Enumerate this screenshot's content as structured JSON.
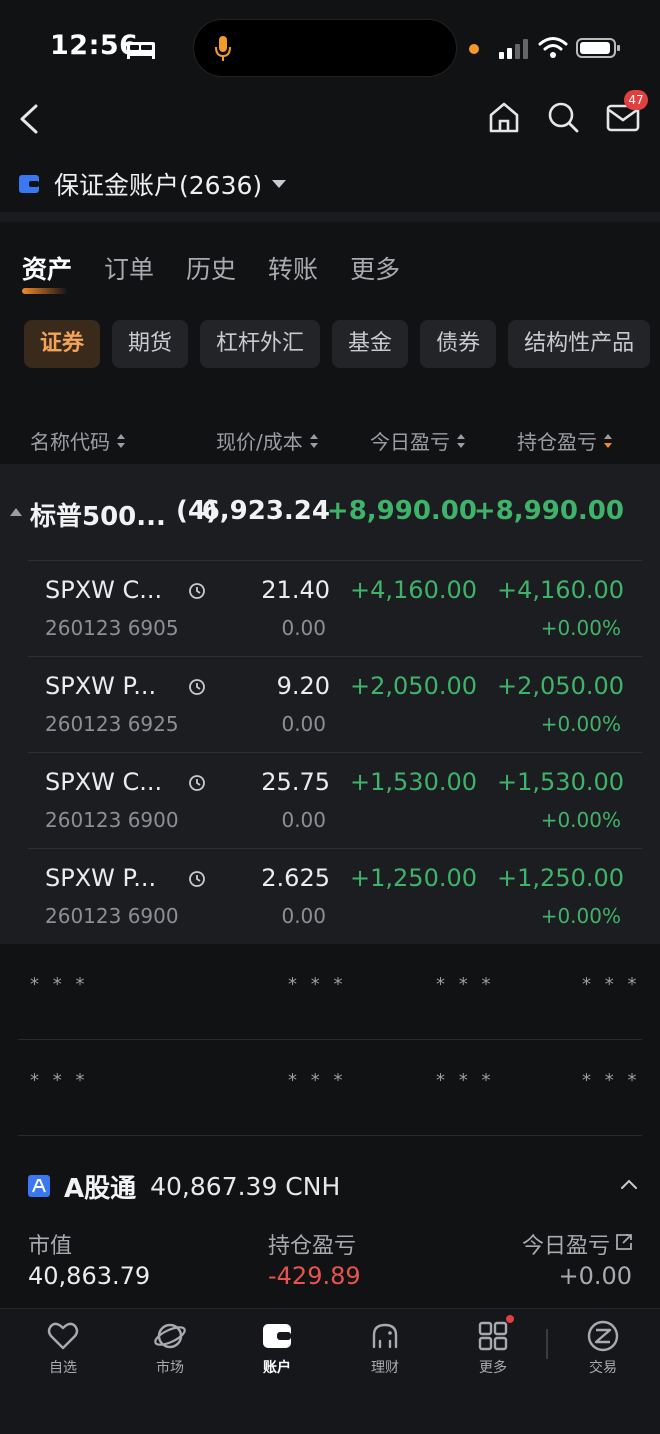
{
  "status_bar": {
    "time": "12:56",
    "icons": [
      "bed-icon",
      "mic-icon",
      "signal-icon",
      "wifi-icon",
      "battery-icon"
    ]
  },
  "nav": {
    "icons": [
      "back-icon",
      "home-icon",
      "search-icon",
      "mail-icon"
    ],
    "mail_badge": "47"
  },
  "account": {
    "name": "保证金账户(2636)"
  },
  "main_tabs": [
    {
      "label": "资产",
      "active": true
    },
    {
      "label": "订单",
      "active": false
    },
    {
      "label": "历史",
      "active": false
    },
    {
      "label": "转账",
      "active": false
    },
    {
      "label": "更多",
      "active": false
    }
  ],
  "sub_tabs": [
    {
      "label": "证券",
      "active": true
    },
    {
      "label": "期货",
      "active": false
    },
    {
      "label": "杠杆外汇",
      "active": false
    },
    {
      "label": "基金",
      "active": false
    },
    {
      "label": "债券",
      "active": false
    },
    {
      "label": "结构性产品",
      "active": false
    }
  ],
  "columns": {
    "name": "名称代码",
    "price": "现价/成本",
    "today": "今日盈亏",
    "pnl": "持仓盈亏"
  },
  "group": {
    "name": "标普500...",
    "count": "(4)",
    "price": "6,923.24",
    "today": "+8,990.00",
    "pnl": "+8,990.00"
  },
  "positions": [
    {
      "name": "SPXW C...",
      "code": "260123 6905",
      "price": "21.40",
      "cost": "0.00",
      "today": "+4,160.00",
      "pnl": "+4,160.00",
      "pct": "+0.00%"
    },
    {
      "name": "SPXW P...",
      "code": "260123 6925",
      "price": "9.20",
      "cost": "0.00",
      "today": "+2,050.00",
      "pnl": "+2,050.00",
      "pct": "+0.00%"
    },
    {
      "name": "SPXW C...",
      "code": "260123 6900",
      "price": "25.75",
      "cost": "0.00",
      "today": "+1,530.00",
      "pnl": "+1,530.00",
      "pct": "+0.00%"
    },
    {
      "name": "SPXW P...",
      "code": "260123 6900",
      "price": "2.625",
      "cost": "0.00",
      "today": "+1,250.00",
      "pnl": "+1,250.00",
      "pct": "+0.00%"
    }
  ],
  "masked_rows": [
    [
      "* * *",
      "* * *",
      "* * *",
      "* * *"
    ],
    [
      "* * *",
      "* * *",
      "* * *",
      "* * *"
    ]
  ],
  "ashare": {
    "name": "A股通",
    "value": "40,867.39 CNH",
    "market_value_label": "市值",
    "market_value": "40,863.79",
    "position_pnl_label": "持仓盈亏",
    "position_pnl": "-429.89",
    "today_pnl_label": "今日盈亏",
    "today_pnl": "+0.00"
  },
  "bottom_nav": [
    {
      "label": "自选",
      "icon": "heart-icon",
      "active": false
    },
    {
      "label": "市场",
      "icon": "planet-icon",
      "active": false
    },
    {
      "label": "账户",
      "icon": "wallet-icon",
      "active": true
    },
    {
      "label": "理财",
      "icon": "piggy-bank-icon",
      "active": false
    },
    {
      "label": "更多",
      "icon": "grid-icon",
      "active": false
    },
    {
      "label": "交易",
      "icon": "trade-icon",
      "active": false
    }
  ],
  "colors": {
    "background": "#111214",
    "accent": "#f28a2a",
    "gain": "#3fb36a",
    "loss": "#e8534f",
    "badge": "#e0403f"
  }
}
